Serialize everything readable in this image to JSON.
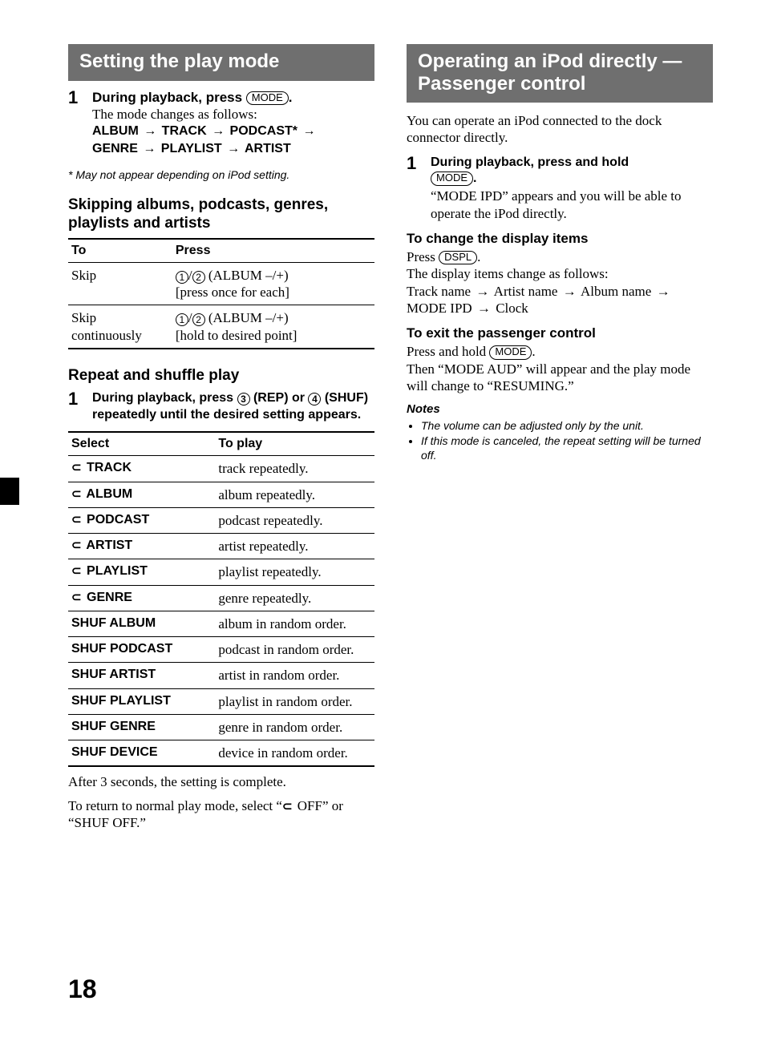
{
  "page_number": "18",
  "left": {
    "banner": "Setting the play mode",
    "step1": {
      "num": "1",
      "lead_a": "During playback, press ",
      "btn": "MODE",
      "lead_b": ".",
      "sub": "The mode changes as follows:",
      "seq": [
        "ALBUM",
        "TRACK",
        "PODCAST",
        "GENRE",
        "PLAYLIST",
        "ARTIST"
      ],
      "seq_star_index": 2
    },
    "ast_note": "May not appear depending on iPod setting.",
    "h2a": "Skipping albums, podcasts, genres, playlists and artists",
    "skip_table": {
      "headers": [
        "To",
        "Press"
      ],
      "rows": [
        {
          "to": "Skip",
          "press_suffix": " (ALBUM –/+)",
          "press_line2": "[press once for each]"
        },
        {
          "to": "Skip continuously",
          "press_suffix": " (ALBUM –/+)",
          "press_line2": "[hold to desired point]"
        }
      ]
    },
    "h2b": "Repeat and shuffle play",
    "step2": {
      "num": "1",
      "part_a": "During playback, press ",
      "rep_label": " (REP) or ",
      "shuf_label": " (SHUF) repeatedly until the desired setting appears."
    },
    "rep_table": {
      "headers": [
        "Select",
        "To play"
      ],
      "rows": [
        {
          "loop": true,
          "select": "TRACK",
          "to_play": "track repeatedly."
        },
        {
          "loop": true,
          "select": "ALBUM",
          "to_play": "album repeatedly."
        },
        {
          "loop": true,
          "select": "PODCAST",
          "to_play": "podcast repeatedly."
        },
        {
          "loop": true,
          "select": "ARTIST",
          "to_play": "artist repeatedly."
        },
        {
          "loop": true,
          "select": "PLAYLIST",
          "to_play": "playlist repeatedly."
        },
        {
          "loop": true,
          "select": "GENRE",
          "to_play": "genre repeatedly."
        },
        {
          "loop": false,
          "select": "SHUF ALBUM",
          "to_play": "album in random order."
        },
        {
          "loop": false,
          "select": "SHUF PODCAST",
          "to_play": "podcast in random order."
        },
        {
          "loop": false,
          "select": "SHUF ARTIST",
          "to_play": "artist in random order."
        },
        {
          "loop": false,
          "select": "SHUF PLAYLIST",
          "to_play": "playlist in random order."
        },
        {
          "loop": false,
          "select": "SHUF GENRE",
          "to_play": "genre in random order."
        },
        {
          "loop": false,
          "select": "SHUF DEVICE",
          "to_play": "device in random order."
        }
      ]
    },
    "after1": "After 3 seconds, the setting is complete.",
    "return_a": "To return to normal play mode, select “",
    "return_b": " OFF” or “SHUF OFF.”"
  },
  "right": {
    "banner": "Operating an iPod directly — Passenger control",
    "intro": "You can operate an iPod connected to the dock connector directly.",
    "step1": {
      "num": "1",
      "lead": "During playback, press and hold ",
      "btn": "MODE",
      "period": ".",
      "sub": "“MODE IPD” appears and you will be able to operate the iPod directly."
    },
    "h3a": "To change the display items",
    "press_a": "Press ",
    "dspl_btn": "DSPL",
    "press_b": ".",
    "disp_change": "The display items change as follows:",
    "disp_seq": [
      "Track name",
      "Artist name",
      "Album name",
      "MODE IPD",
      "Clock"
    ],
    "h3b": "To exit the passenger control",
    "exit_a": "Press and hold ",
    "exit_btn": "MODE",
    "exit_b": ".",
    "exit_sub": "Then “MODE AUD” will appear and the play mode will change to “RESUMING.”",
    "notes_head": "Notes",
    "notes": [
      "The volume can be adjusted only by the unit.",
      "If this mode is canceled, the repeat setting will be turned off."
    ]
  }
}
